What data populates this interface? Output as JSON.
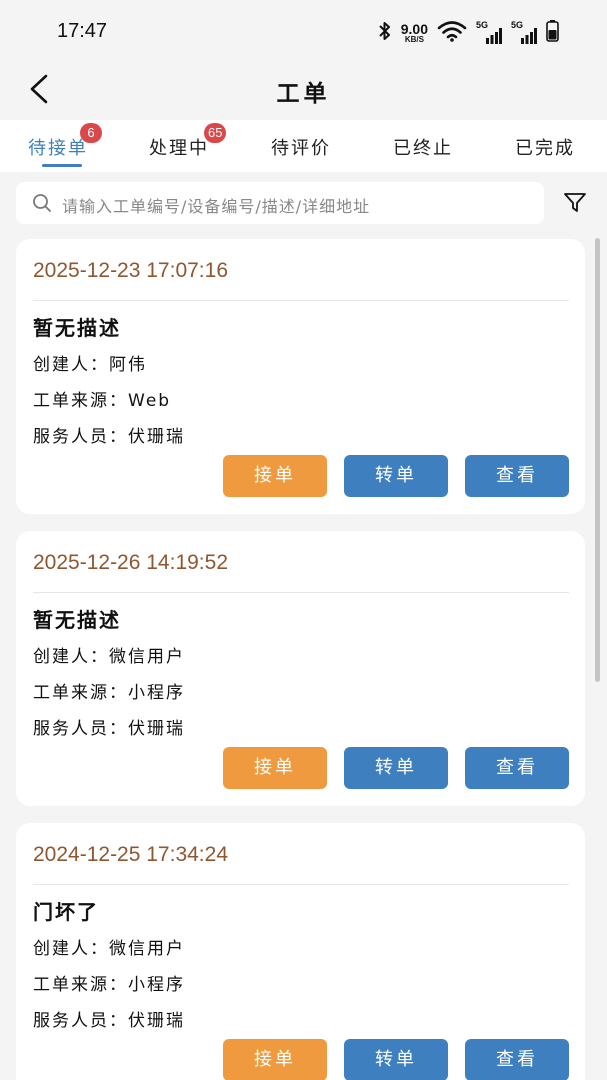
{
  "status_bar": {
    "time": "17:47",
    "net_speed_value": "9.00",
    "net_speed_unit": "KB/S",
    "signal_1_label": "5G",
    "signal_2_label": "5G"
  },
  "nav": {
    "title": "工单"
  },
  "tabs": [
    {
      "label": "待接单",
      "badge": "6"
    },
    {
      "label": "处理中",
      "badge": "65"
    },
    {
      "label": "待评价"
    },
    {
      "label": "已终止"
    },
    {
      "label": "已完成"
    }
  ],
  "search": {
    "placeholder": "请输入工单编号/设备编号/描述/详细地址"
  },
  "orders": [
    {
      "time": "2025-12-23 17:07:16",
      "description": "暂无描述",
      "creator": "创建人：阿伟",
      "source": "工单来源：Web",
      "staff": "服务人员：伏珊瑞",
      "accept_label": "接单",
      "transfer_label": "转单",
      "view_label": "查看"
    },
    {
      "time": "2025-12-26 14:19:52",
      "description": "暂无描述",
      "creator": "创建人：微信用户",
      "source": "工单来源：小程序",
      "staff": "服务人员：伏珊瑞",
      "accept_label": "接单",
      "transfer_label": "转单",
      "view_label": "查看"
    },
    {
      "time": "2024-12-25 17:34:24",
      "description": "门坏了",
      "creator": "创建人：微信用户",
      "source": "工单来源：小程序",
      "staff": "服务人员：伏珊瑞",
      "accept_label": "接单",
      "transfer_label": "转单",
      "view_label": "查看"
    }
  ],
  "colors": {
    "accent": "#3e7fbf",
    "accept_button": "#ef9a3e",
    "badge": "#d9484a",
    "timestamp": "#8f5730"
  }
}
